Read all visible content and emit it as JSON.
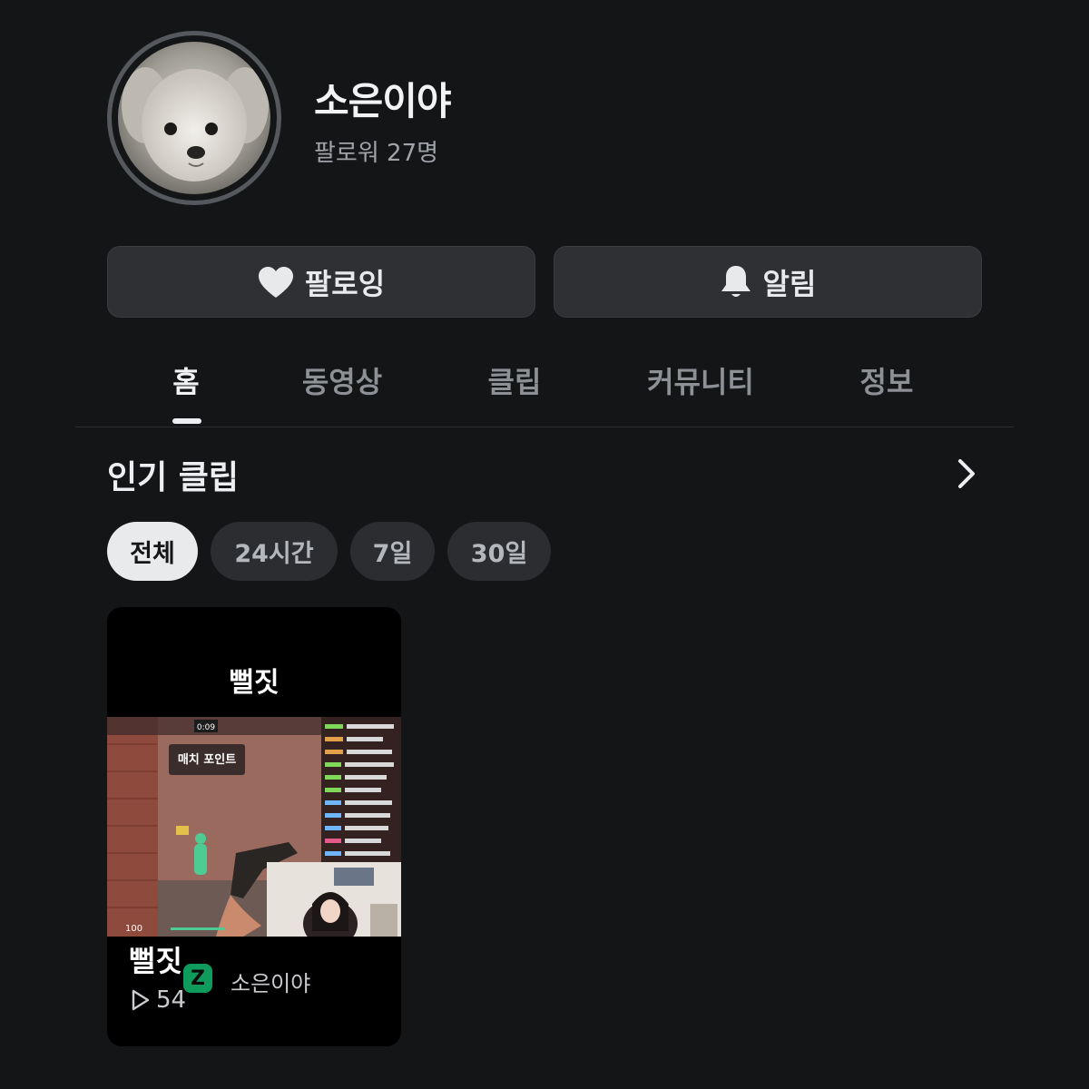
{
  "profile": {
    "name": "소은이야",
    "followers": "팔로워 27명"
  },
  "actions": {
    "follow_label": "팔로잉",
    "alert_label": "알림"
  },
  "tabs": [
    {
      "label": "홈",
      "active": true
    },
    {
      "label": "동영상",
      "active": false
    },
    {
      "label": "클립",
      "active": false
    },
    {
      "label": "커뮤니티",
      "active": false
    },
    {
      "label": "정보",
      "active": false
    }
  ],
  "section": {
    "title": "인기 클립",
    "more_icon": "chevron-right-icon"
  },
  "filters": [
    {
      "label": "전체",
      "active": true
    },
    {
      "label": "24시간",
      "active": false
    },
    {
      "label": "7일",
      "active": false
    },
    {
      "label": "30일",
      "active": false
    }
  ],
  "clip": {
    "top_title": "뻘짓",
    "title": "뻘짓",
    "author": "소은이야",
    "logo_letter": "Z",
    "views": "54",
    "overlay": {
      "match_point": "매치 포인트",
      "timer": "0:09",
      "health": "100"
    }
  },
  "colors": {
    "background": "#141517",
    "button": "#2e3034",
    "chip": "#2b2d30",
    "chip_active": "#e9eaec",
    "brand_green": "#0e9b5b"
  }
}
